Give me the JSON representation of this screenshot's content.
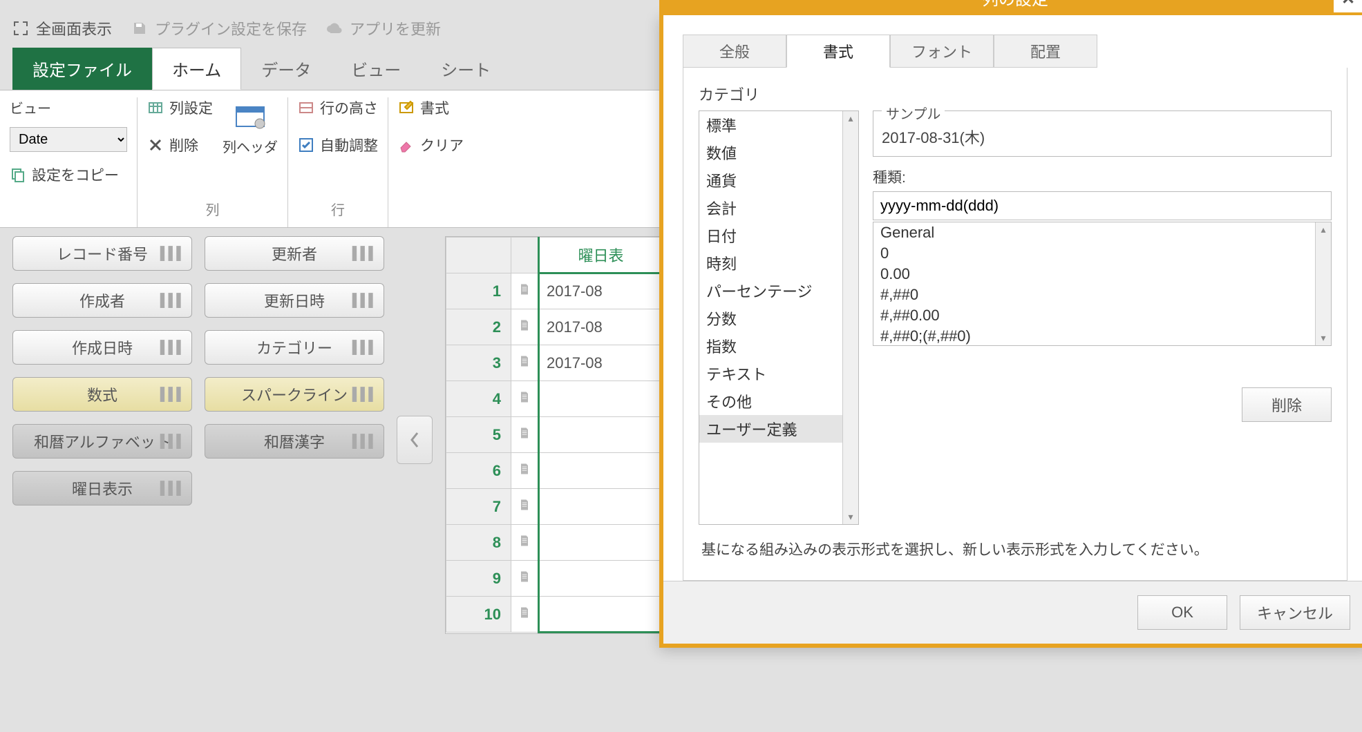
{
  "topbar": {
    "fullscreen": "全画面表示",
    "save_plugin": "プラグイン設定を保存",
    "update_app": "アプリを更新"
  },
  "tabs": {
    "file": "設定ファイル",
    "home": "ホーム",
    "data": "データ",
    "view": "ビュー",
    "sheet": "シート"
  },
  "ribbon": {
    "view_label": "ビュー",
    "view_value": "Date",
    "copy_settings": "設定をコピー",
    "col_settings": "列設定",
    "delete": "削除",
    "col_header": "列ヘッダ",
    "group_col": "列",
    "row_height": "行の高さ",
    "auto_adjust": "自動調整",
    "group_row": "行",
    "format": "書式",
    "clear": "クリア"
  },
  "fields": {
    "left": [
      "レコード番号",
      "作成者",
      "作成日時",
      "数式",
      "和暦アルファベット",
      "曜日表示"
    ],
    "right": [
      "更新者",
      "更新日時",
      "カテゴリー",
      "スパークライン",
      "和暦漢字"
    ]
  },
  "grid": {
    "header": "曜日表",
    "rows": [
      {
        "n": "1",
        "v": "2017-08"
      },
      {
        "n": "2",
        "v": "2017-08"
      },
      {
        "n": "3",
        "v": "2017-08"
      },
      {
        "n": "4",
        "v": ""
      },
      {
        "n": "5",
        "v": ""
      },
      {
        "n": "6",
        "v": ""
      },
      {
        "n": "7",
        "v": ""
      },
      {
        "n": "8",
        "v": ""
      },
      {
        "n": "9",
        "v": ""
      },
      {
        "n": "10",
        "v": ""
      }
    ]
  },
  "modal": {
    "title": "列の設定",
    "tabs": [
      "全般",
      "書式",
      "フォント",
      "配置"
    ],
    "selected_tab": 1,
    "category_label": "カテゴリ",
    "categories": [
      "標準",
      "数値",
      "通貨",
      "会計",
      "日付",
      "時刻",
      "パーセンテージ",
      "分数",
      "指数",
      "テキスト",
      "その他",
      "ユーザー定義"
    ],
    "selected_category_index": 11,
    "sample_label": "サンプル",
    "sample_value": "2017-08-31(木)",
    "kind_label": "種類:",
    "kind_value": "yyyy-mm-dd(ddd)",
    "format_options": [
      "General",
      "0",
      "0.00",
      "#,##0",
      "#,##0.00",
      "#,##0;(#,##0)"
    ],
    "delete_btn": "削除",
    "note": "基になる組み込みの表示形式を選択し、新しい表示形式を入力してください。",
    "ok": "OK",
    "cancel": "キャンセル"
  }
}
